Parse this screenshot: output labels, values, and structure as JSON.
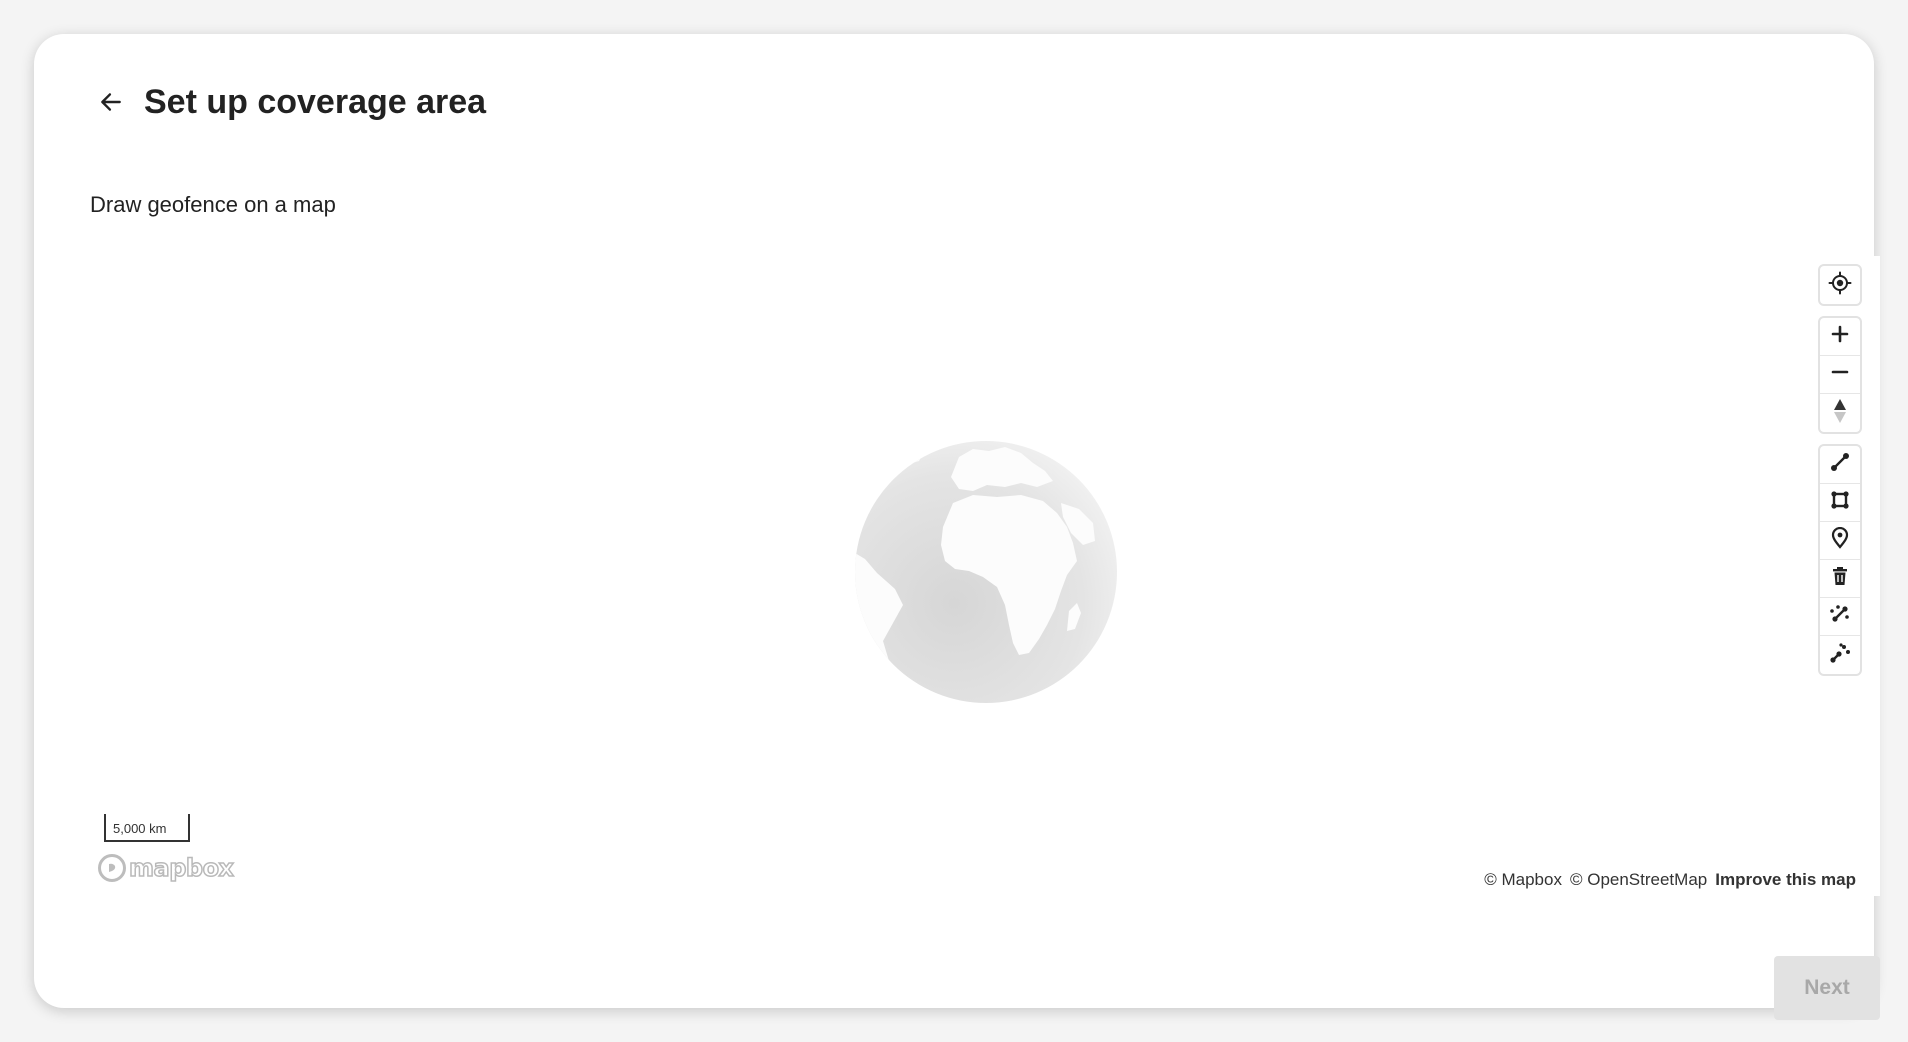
{
  "header": {
    "title": "Set up coverage area",
    "back_icon": "arrow-left-icon"
  },
  "section": {
    "subtitle": "Draw geofence on a map"
  },
  "map": {
    "scale_label": "5,000 km",
    "logo_text": "mapbox",
    "attribution": {
      "mapbox": "© Mapbox",
      "osm": "© OpenStreetMap",
      "improve": "Improve this map"
    },
    "controls": {
      "geolocate": "geolocate-icon",
      "zoom_in": "plus-icon",
      "zoom_out": "minus-icon",
      "compass": "compass-icon",
      "draw_tools": [
        "line-string-icon",
        "polygon-icon",
        "point-marker-icon",
        "trash-icon",
        "combine-icon",
        "uncombine-icon"
      ]
    }
  },
  "footer": {
    "next_label": "Next",
    "next_enabled": false
  },
  "colors": {
    "card_background": "#ffffff",
    "page_background": "#f4f4f4",
    "text_primary": "#222222",
    "disabled_button_bg": "#e2e2e2",
    "disabled_button_text": "#a8a8a8",
    "globe_ocean": "#e0e0e0",
    "globe_land": "#fcfcfc"
  }
}
